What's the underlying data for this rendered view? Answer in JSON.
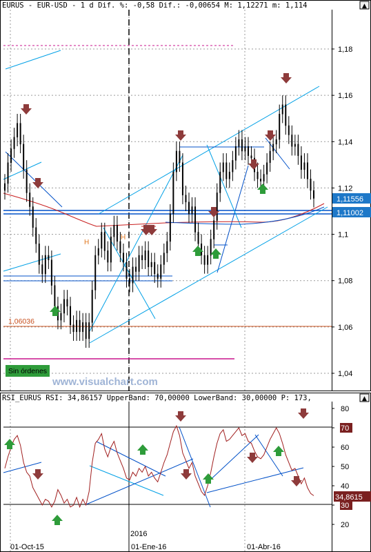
{
  "header": {
    "price_line": "EURUS - EUR-USD -   1 d Dif. %: -0,58 Dif.: -0,00654 M: 1,12271 m: 1,114",
    "rsi_line": "RSI_EURUS RSI: 34,86157 UpperBand: 70,00000 LowerBand: 30,00000 P: 173,"
  },
  "labels": {
    "support_level": "1,06036",
    "orders_badge": "Sin órdenes",
    "watermark": "www.visualchart.com",
    "h_left": "H",
    "h_right": "H"
  },
  "colors": {
    "candle": "#000000",
    "trend_light": "#00a0e6",
    "trend_dark": "#0050c8",
    "ma": "#c81e1e",
    "rsi": "#a01e1e",
    "up_arrow": "#2e9c3a",
    "down_arrow": "#8e3b3b",
    "support": "#c8501e",
    "magenta": "#c8148c",
    "badge_bg": "#2e9c3a",
    "price_box": "#1e78c8",
    "rsi_box": "#7a2020"
  },
  "chart_data": [
    {
      "type": "candlestick",
      "title": "EURUS - EUR-USD",
      "price_axis_ticks": [
        "1,18",
        "1,16",
        "1,14",
        "1,12",
        "1,1",
        "1,08",
        "1,06",
        "1,04"
      ],
      "ylim": [
        1.0325,
        1.1975
      ],
      "x_labels": [
        "01-Oct-15",
        "01-Ene-16",
        "01-Abr-16"
      ],
      "year_marker": "2016",
      "last_close": 1.114,
      "current_price_labels": [
        "1,11556",
        "1,11002"
      ],
      "support_value": 1.06036,
      "close_series": [
        1.122,
        1.131,
        1.137,
        1.142,
        1.148,
        1.139,
        1.128,
        1.118,
        1.112,
        1.103,
        1.096,
        1.087,
        1.083,
        1.091,
        1.089,
        1.078,
        1.069,
        1.063,
        1.066,
        1.072,
        1.069,
        1.061,
        1.058,
        1.063,
        1.058,
        1.062,
        1.055,
        1.062,
        1.076,
        1.091,
        1.094,
        1.101,
        1.093,
        1.088,
        1.099,
        1.104,
        1.097,
        1.092,
        1.088,
        1.081,
        1.079,
        1.086,
        1.084,
        1.091,
        1.089,
        1.093,
        1.086,
        1.088,
        1.083,
        1.081,
        1.087,
        1.092,
        1.097,
        1.109,
        1.127,
        1.136,
        1.131,
        1.117,
        1.114,
        1.109,
        1.112,
        1.101,
        1.096,
        1.091,
        1.087,
        1.091,
        1.098,
        1.106,
        1.118,
        1.127,
        1.131,
        1.124,
        1.127,
        1.132,
        1.138,
        1.141,
        1.136,
        1.138,
        1.134,
        1.133,
        1.127,
        1.124,
        1.123,
        1.126,
        1.131,
        1.136,
        1.139,
        1.141,
        1.152,
        1.156,
        1.147,
        1.143,
        1.138,
        1.139,
        1.134,
        1.128,
        1.131,
        1.124,
        1.119,
        1.1156
      ],
      "rsi": {
        "axis_ticks": [
          "80",
          "70",
          "60",
          "50",
          "40",
          "30",
          "20"
        ],
        "ylim": [
          14,
          84
        ],
        "upper_band": 70,
        "lower_band": 30,
        "last_value_label": "34,8615",
        "values": [
          49,
          55,
          60,
          64,
          66,
          61,
          52,
          47,
          45,
          39,
          36,
          33,
          30,
          33,
          32,
          29,
          32,
          38,
          35,
          31,
          33,
          29,
          30,
          34,
          29,
          33,
          30,
          37,
          52,
          62,
          64,
          67,
          59,
          55,
          60,
          63,
          57,
          53,
          49,
          44,
          43,
          47,
          45,
          49,
          47,
          50,
          45,
          47,
          44,
          42,
          47,
          52,
          56,
          62,
          68,
          71,
          66,
          57,
          53,
          49,
          52,
          45,
          41,
          37,
          35,
          40,
          47,
          55,
          62,
          67,
          69,
          63,
          64,
          66,
          68,
          70,
          66,
          67,
          63,
          62,
          58,
          55,
          54,
          56,
          60,
          64,
          67,
          70,
          67,
          62,
          56,
          52,
          48,
          49,
          45,
          41,
          44,
          39,
          36,
          34.86
        ]
      }
    }
  ]
}
